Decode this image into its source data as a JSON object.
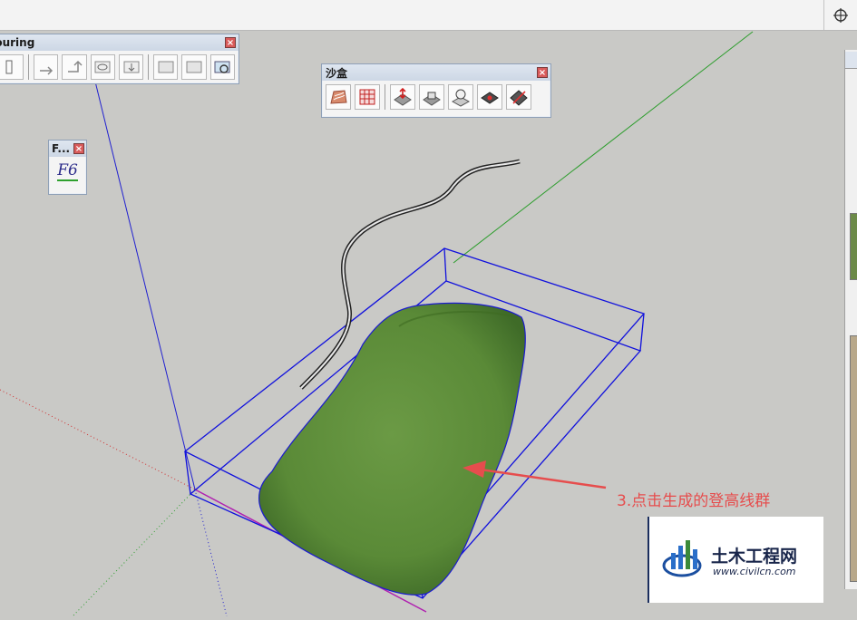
{
  "contouring_toolbar": {
    "title": "Contouring",
    "close_label": "×"
  },
  "sandbox_toolbar": {
    "title": "沙盒",
    "close_label": "×",
    "tools": [
      "contour-tool",
      "grid-tool",
      "smoove-tool",
      "stamp-tool",
      "drape-tool",
      "add-detail-tool",
      "flip-edge-tool"
    ]
  },
  "font_toolbar": {
    "title": "F...",
    "button": "F6",
    "close_label": "×"
  },
  "annotation": {
    "text": "3.点击生成的登高线群",
    "color": "#e64d4d"
  },
  "watermark": {
    "title": "土木工程网",
    "url": "www.civilcn.com"
  },
  "colors": {
    "axis_green": "#2d9d2d",
    "axis_blue": "#2020d0",
    "axis_red": "#d03030",
    "terrain": "#5e8c3a",
    "bbox": "#1010dd",
    "viewport_bg": "#c9c9c6"
  }
}
